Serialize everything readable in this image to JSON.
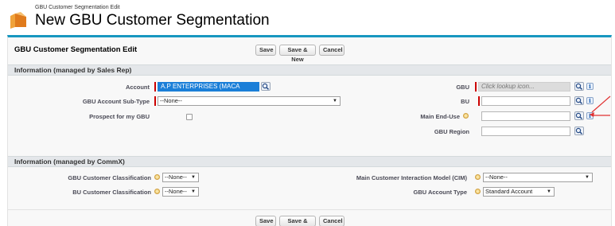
{
  "header": {
    "subtitle": "GBU Customer Segmentation Edit",
    "title": "New GBU Customer Segmentation"
  },
  "block": {
    "title": "GBU Customer Segmentation Edit",
    "buttons": {
      "save": "Save",
      "save_new": "Save & New",
      "cancel": "Cancel"
    }
  },
  "sales_section": {
    "title": "Information (managed by Sales Rep)",
    "account_label": "Account",
    "account_value": "A.P ENTERPRISES (MACA",
    "sub_type_label": "GBU Account Sub-Type",
    "sub_type_value": "--None--",
    "prospect_label": "Prospect for my GBU",
    "gbu_label": "GBU",
    "gbu_placeholder": "Click lookup icon...",
    "bu_label": "BU",
    "bu_value": "",
    "end_use_label": "Main End-Use",
    "end_use_value": "",
    "region_label": "GBU Region",
    "region_value": ""
  },
  "commx_section": {
    "title": "Information (managed by CommX)",
    "gbu_class_label": "GBU Customer Classification",
    "gbu_class_value": "--None--",
    "bu_class_label": "BU Customer Classification",
    "bu_class_value": "--None--",
    "cim_label": "Main Customer Interaction Model (CIM)",
    "cim_value": "--None--",
    "account_type_label": "GBU Account Type",
    "account_type_value": "Standard Account"
  },
  "colors": {
    "accent": "#1797c0",
    "required": "#cc0000",
    "annotation": "#e03030"
  },
  "icons": [
    "segmentation-icon",
    "lookup-icon",
    "info-icon",
    "help-icon",
    "dropdown-arrow-icon"
  ]
}
